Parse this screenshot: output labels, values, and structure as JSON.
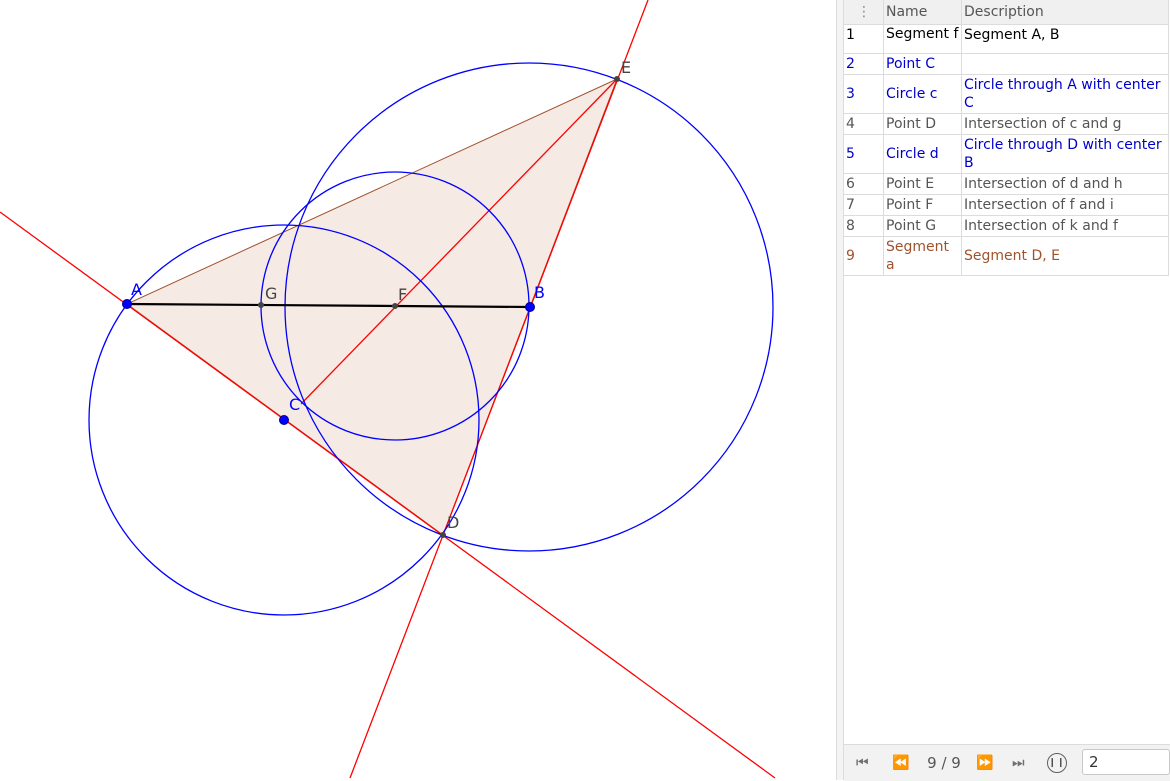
{
  "graphics": {
    "points": {
      "A": {
        "label": "A"
      },
      "B": {
        "label": "B"
      },
      "C": {
        "label": "C"
      },
      "D": {
        "label": "D"
      },
      "E": {
        "label": "E"
      },
      "F": {
        "label": "F"
      },
      "G": {
        "label": "G"
      }
    },
    "colors": {
      "line": "#ff0000",
      "circle": "#0000ff",
      "polygon_fill": "#f5e6e0",
      "polygon_edge": "#a0522d",
      "segment": "#000000",
      "free_point": "#0000ff",
      "dependent_point": "#444444"
    }
  },
  "construction_protocol": {
    "menu_icon": "vertical-dots-icon",
    "headers": {
      "name": "Name",
      "description": "Description"
    },
    "rows": [
      {
        "num": "1",
        "name": "Segment f",
        "description": "Segment A, B",
        "color": "#000000"
      },
      {
        "num": "2",
        "name": "Point C",
        "description": "",
        "color": "#0000cc"
      },
      {
        "num": "3",
        "name": "Circle c",
        "description": "Circle through A with center C",
        "color": "#0000cc"
      },
      {
        "num": "4",
        "name": "Point D",
        "description": "Intersection of c and g",
        "color": "#555555"
      },
      {
        "num": "5",
        "name": "Circle d",
        "description": "Circle through D with center B",
        "color": "#0000cc"
      },
      {
        "num": "6",
        "name": "Point E",
        "description": "Intersection of d and h",
        "color": "#555555"
      },
      {
        "num": "7",
        "name": "Point F",
        "description": "Intersection of f and i",
        "color": "#555555"
      },
      {
        "num": "8",
        "name": "Point G",
        "description": "Intersection of k and f",
        "color": "#555555"
      },
      {
        "num": "9",
        "name": "Segment a",
        "description": "Segment D, E",
        "color": "#a0522d"
      }
    ]
  },
  "navigation": {
    "first_icon": "skip-to-start-icon",
    "prev_icon": "rewind-icon",
    "step": "9 / 9",
    "next_icon": "fast-forward-icon",
    "last_icon": "skip-to-end-icon",
    "play_icon": "pause-icon",
    "speed_value": "2"
  }
}
